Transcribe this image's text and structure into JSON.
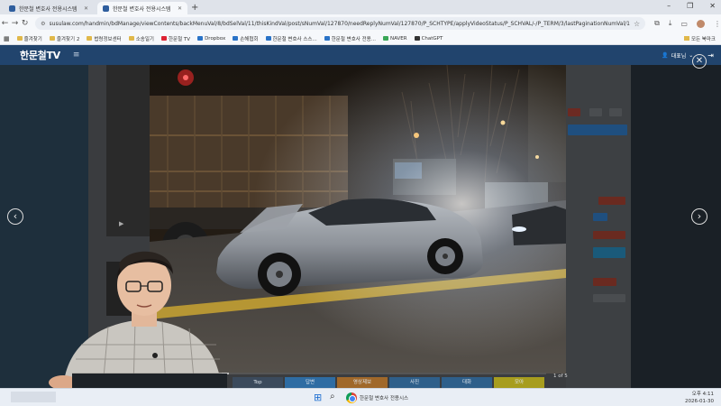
{
  "browser": {
    "tabs": [
      {
        "label": "한문철 변호사 전용시스템",
        "active": false
      },
      {
        "label": "한문철 변호사 전용시스템",
        "active": true
      }
    ],
    "new_tab": "+",
    "window_controls": {
      "minimize": "–",
      "maximize": "❐",
      "close": "✕"
    },
    "url": "susulaw.com/handmin/bdManage/viewContents/backMenuVal/8/bdSelVal/11/thisKindVal/post/sNumVal/127870/needReplyNumVal/127870/P_SCHTYPE/applyVideoStatus/P_SCHVAL/-/P_TERM/3/lastPaginationNumVal/1",
    "bookmarks": [
      {
        "label": "즐겨찾기",
        "icon": "folder"
      },
      {
        "label": "즐겨찾기 2",
        "icon": "folder"
      },
      {
        "label": "법령정보센터",
        "icon": "folder"
      },
      {
        "label": "소송일기",
        "icon": "folder"
      },
      {
        "label": "한문철 TV",
        "icon": "youtube"
      },
      {
        "label": "Dropbox",
        "icon": "dropbox"
      },
      {
        "label": "손해협회",
        "icon": "page"
      },
      {
        "label": "한문철 변호사 스스...",
        "icon": "page"
      },
      {
        "label": "한문철 변호사 전용...",
        "icon": "page"
      },
      {
        "label": "NAVER",
        "icon": "naver"
      },
      {
        "label": "ChatGPT",
        "icon": "chatgpt"
      }
    ],
    "all_bookmarks": "모든 북마크"
  },
  "app": {
    "logo": "한문철TV",
    "user": "대표님",
    "bottom_tabs": [
      {
        "label": "Top",
        "color": "#3b4a5c"
      },
      {
        "label": "답변",
        "color": "#2e6ca3"
      },
      {
        "label": "영상제보",
        "color": "#a0682a"
      },
      {
        "label": "사진",
        "color": "#2e5f8a"
      },
      {
        "label": "대화",
        "color": "#2e5f8a"
      },
      {
        "label": "모아",
        "color": "#a79d1e"
      }
    ]
  },
  "viewer": {
    "counter": "1 of 5",
    "prev": "‹",
    "next": "›",
    "close": "✕",
    "progress": 0.2
  },
  "taskbar": {
    "app_label": "한문철 변호사 전용시스",
    "time": "오후 4:11",
    "date": "2026-01-30"
  }
}
